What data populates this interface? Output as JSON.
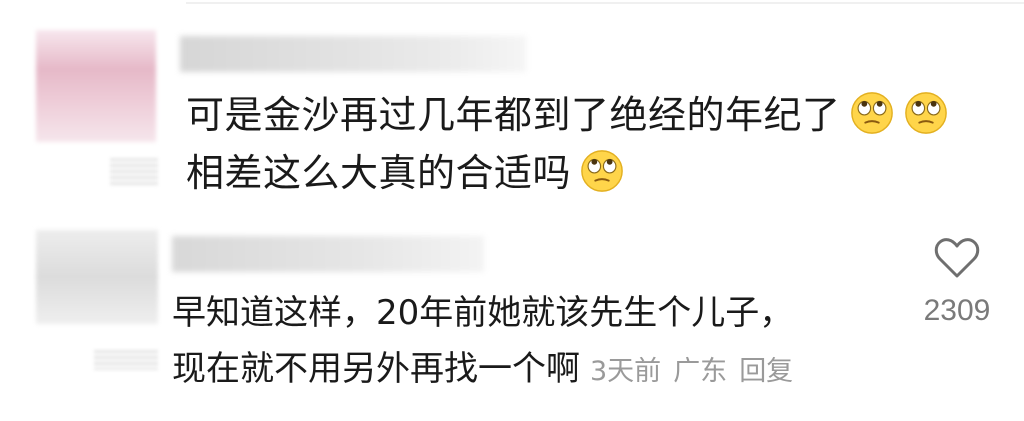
{
  "comments": [
    {
      "username": "",
      "text_lines": [
        "可是金沙再过几年都到了绝经的年纪了",
        "相差这么大真的合适吗"
      ],
      "emoji": "eye-roll-emoji"
    },
    {
      "username": "",
      "text_lines": [
        "早知道这样，20年前她就该先生个儿子，",
        "现在就不用另外再找一个啊"
      ],
      "time": "3天前",
      "location": "广东",
      "reply_label": "回复",
      "like_count": "2309",
      "like_icon": "heart-outline-icon"
    }
  ],
  "colors": {
    "text": "#1a1a1a",
    "meta": "#9a9a9a",
    "like_count": "#7a7a7a"
  }
}
